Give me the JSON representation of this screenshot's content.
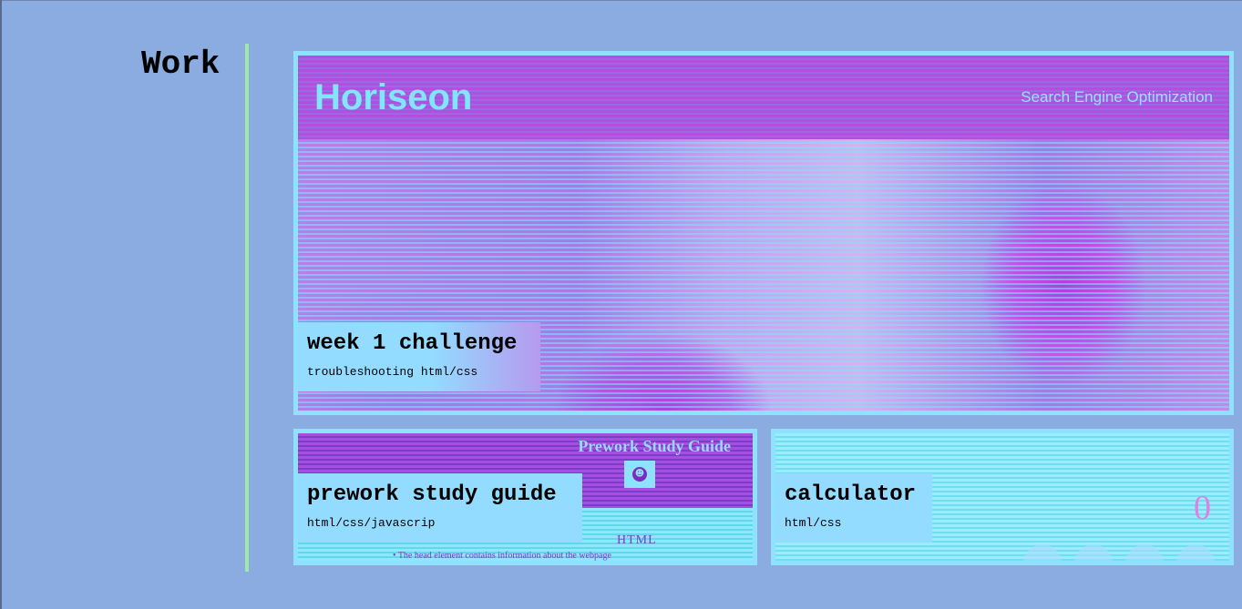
{
  "section": {
    "title": "Work"
  },
  "projects": [
    {
      "title": "week 1 challenge",
      "subtitle": "troubleshooting html/css",
      "preview": {
        "logo": "Horiseon",
        "tagline": "Search Engine Optimization"
      }
    },
    {
      "title": "prework study guide",
      "subtitle": "html/css/javascrip",
      "preview": {
        "heading": "Prework Study Guide",
        "section_label": "HTML",
        "bullet": "The head element contains information about the webpage"
      }
    },
    {
      "title": "calculator",
      "subtitle": "html/css",
      "preview": {
        "display": "0"
      }
    }
  ],
  "colors": {
    "background": "#8aace0",
    "divider": "#9fe8a8",
    "card_border": "#8fe2ff",
    "caption_bg": "#93dcff",
    "magenta": "#a64ee0"
  }
}
